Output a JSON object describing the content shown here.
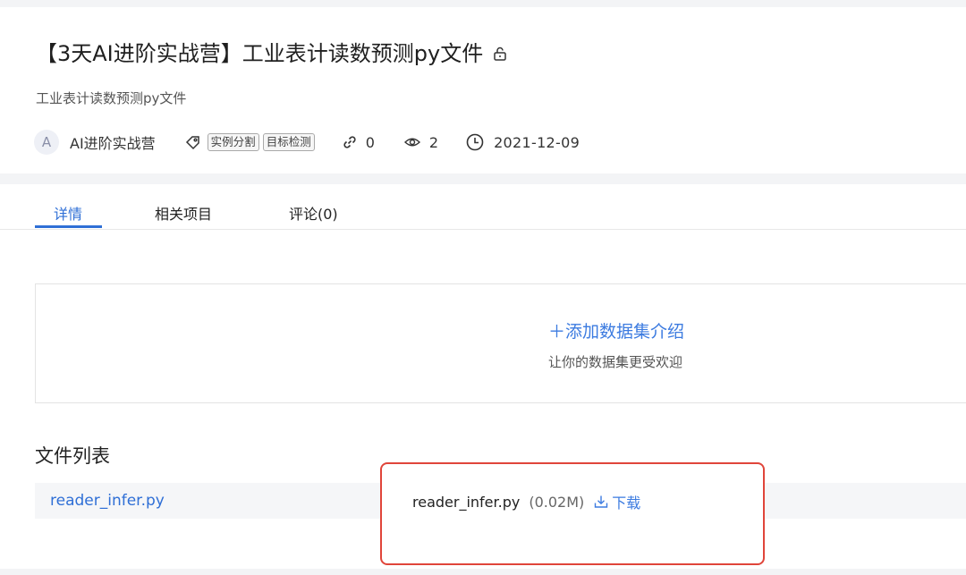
{
  "project": {
    "title": "【3天AI进阶实战营】工业表计读数预测py文件",
    "subtitle": "工业表计读数预测py文件",
    "owner_avatar": "A",
    "owner": "AI进阶实战营",
    "tags": [
      "实例分割",
      "目标检测"
    ],
    "forks": "0",
    "views": "2",
    "date": "2021-12-09"
  },
  "tabs": [
    {
      "label": "详情",
      "active": true
    },
    {
      "label": "相关项目",
      "active": false
    },
    {
      "label": "评论(0)",
      "active": false
    }
  ],
  "intro": {
    "add_label": "＋添加数据集介绍",
    "hint": "让你的数据集更受欢迎"
  },
  "files": {
    "heading": "文件列表",
    "items": [
      {
        "name": "reader_infer.py",
        "size": "(0.02M)",
        "download_label": "下载"
      }
    ]
  },
  "colors": {
    "accent": "#2f6fd6",
    "highlight_border": "#e0453a"
  },
  "icons": [
    "lock-icon",
    "tag-icon",
    "link-icon",
    "eye-icon",
    "clock-icon",
    "download-icon"
  ]
}
